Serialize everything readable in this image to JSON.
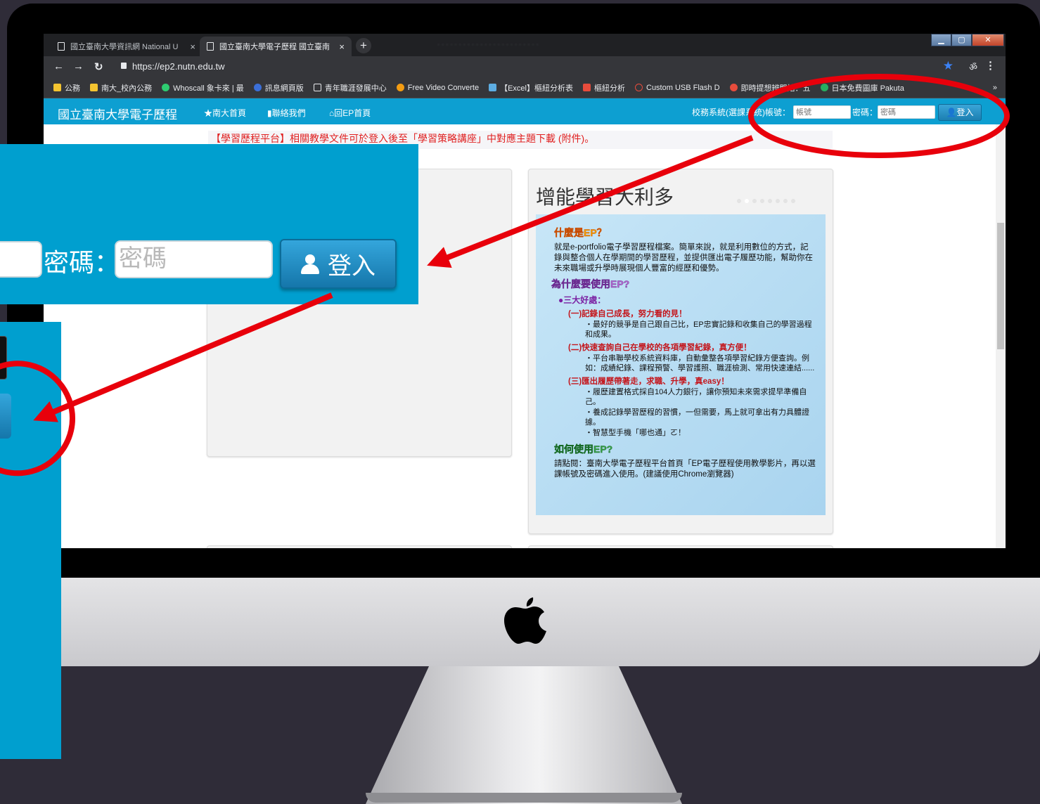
{
  "browser": {
    "tabs": [
      {
        "title": "國立臺南大學資訊網 National U",
        "close": "×"
      },
      {
        "title": "國立臺南大學電子歷程 國立臺南",
        "close": "×"
      }
    ],
    "new_tab": "+",
    "url": "https://ep2.nutn.edu.tw",
    "bookmarks": [
      {
        "label": "公務",
        "color": "#f4c430"
      },
      {
        "label": "南大_校內公務",
        "color": "#f4c430"
      },
      {
        "label": "Whoscall 象卡來 | 最",
        "color": "#2ecc71"
      },
      {
        "label": "訊息網頁版",
        "color": "#3b6fd8"
      },
      {
        "label": "青年職涯發展中心",
        "color": "#e8eaed"
      },
      {
        "label": "Free Video Converte",
        "color": "#f39c12"
      },
      {
        "label": "【Excel】樞紐分析表",
        "color": "#5dade2"
      },
      {
        "label": "樞紐分析",
        "color": "#e74c3c"
      },
      {
        "label": "Custom USB Flash D",
        "color": "#e74c3c"
      },
      {
        "label": "即時提想辨開始：五",
        "color": "#e74c3c"
      },
      {
        "label": "日本免費圖庫 Pakuta",
        "color": "#27ae60"
      }
    ],
    "more_bookmarks": "»"
  },
  "site": {
    "brand": "國立臺南大學電子歷程",
    "nav": [
      "★南大首頁",
      "聯絡我們",
      "回EP首頁"
    ],
    "login": {
      "account_label": "校務系統(選課系統)帳號：",
      "account_placeholder": "帳號",
      "password_label": "密碼：",
      "password_placeholder": "密碼",
      "login_button": "登入"
    },
    "notice": "【學習歷程平台】相關教學文件可於登入後至「學習策略講座」中對應主題下載 (附件)。",
    "panel_title": "增能學習大利多",
    "slide": {
      "q1": "什麼是EP？",
      "a1": "就是e-portfolio電子學習歷程檔案。簡單來說，就是利用數位的方式，記錄與整合個人在學期間的學習歷程，並提供匯出電子履歷功能，幫助你在未來職場或升學時展現個人豐富的經歷和優勢。",
      "q2": "為什麼要使用EP?",
      "bullet": "●三大好處：",
      "b1_title": "(一)記錄自己成長，努力看的見！",
      "b1_text": "‧最好的競爭是自己跟自己比，EP忠實記錄和收集自己的學習過程和成果。",
      "b2_title": "(二)快速查詢自己在學校的各項學習紀錄，真方便！",
      "b2_text": "‧平台串聯學校系統資料庫，自動彙整各項學習紀錄方便查詢。例如：成績紀錄、課程預警、學習護照、職涯檢測、常用快速連結......",
      "b3_title": "(三)匯出履歷帶著走，求職、升學，真easy！",
      "b3_text1": "‧履歷建置格式採自104人力銀行，讓你預知未來需求提早準備自己。",
      "b3_text2": "‧養成記錄學習歷程的習慣，一但需要，馬上就可拿出有力具體證據。",
      "b3_text3": "‧智慧型手機「哪也通」ㄛ！",
      "q3": "如何使用EP?",
      "a3": "請點閱：臺南大學電子歷程平台首頁「EP電子歷程使用教學影片，再以選課帳號及密碼進入使用。(建議使用Chrome瀏覽器)"
    }
  },
  "zoom": {
    "password_label": "密碼：",
    "password_placeholder": "密碼",
    "login_button": "登入"
  },
  "colors": {
    "site_blue": "#0d9fd1",
    "annotation_red": "#e8000b"
  }
}
